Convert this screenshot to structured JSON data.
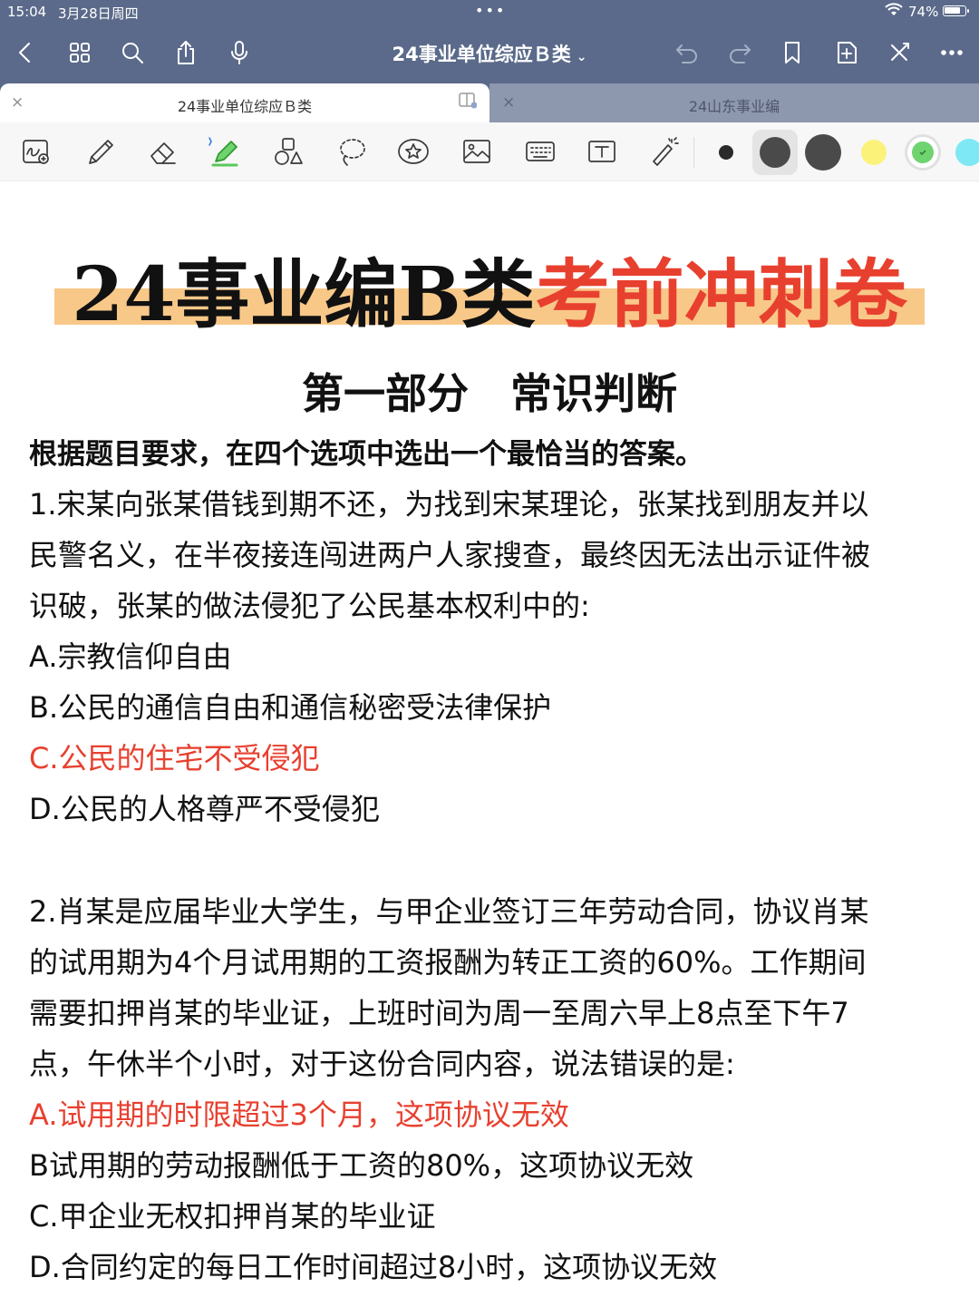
{
  "status_bar": {
    "time": "15:04",
    "date": "3月28日周四",
    "dots": "•••",
    "battery": "74%"
  },
  "navbar": {
    "doc_title": "24事业单位综应Ｂ类",
    "title_chevron": "⌄"
  },
  "tabs": [
    {
      "label": "24事业单位综应Ｂ类",
      "close": "×"
    },
    {
      "label": "24山东事业编",
      "close": "×"
    }
  ],
  "toolbar": {
    "colors": [
      "#2a2a2a",
      "#4a4a4a",
      "#4a4a4a",
      "#fbf27a",
      "#6fd36f",
      "#7ee8f4"
    ]
  },
  "page": {
    "title_part1": "24事业编B类",
    "title_part2": "考前冲刺卷",
    "section_title": "第一部分　常识判断",
    "instruction": "根据题目要求，在四个选项中选出一个最恰当的答案。",
    "lines": [
      "1.宋某向张某借钱到期不还，为找到宋某理论，张某找到朋友并以",
      "民警名义，在半夜接连闯进两户人家搜查，最终因无法出示证件被",
      "识破，张某的做法侵犯了公民基本权利中的:",
      "A.宗教信仰自由",
      "B.公民的通信自由和通信秘密受法律保护",
      "C.公民的住宅不受侵犯",
      "D.公民的人格尊严不受侵犯",
      "2.肖某是应届毕业大学生，与甲企业签订三年劳动合同，协议肖某",
      "的试用期为4个月试用期的工资报酬为转正工资的60%。工作期间",
      "需要扣押肖某的毕业证，上班时间为周一至周六早上8点至下午7",
      "点，午休半个小时，对于这份合同内容，说法错误的是:",
      "A.试用期的时限超过3个月，这项协议无效",
      "B试用期的劳动报酬低于工资的80%，这项协议无效",
      "C.甲企业无权扣押肖某的毕业证",
      "D.合同约定的每日工作时间超过8小时，这项协议无效"
    ],
    "highlight_color": "#e8402f"
  }
}
